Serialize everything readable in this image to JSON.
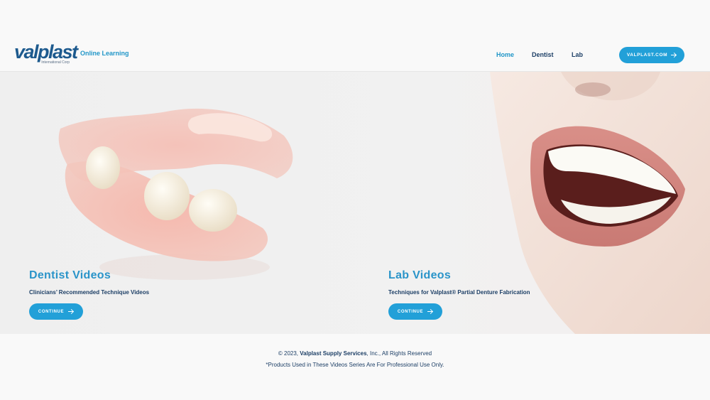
{
  "header": {
    "logo_text": "valplast",
    "logo_subtext": "International Corp",
    "section_label": "Online Learning",
    "nav": [
      {
        "label": "Home",
        "active": true
      },
      {
        "label": "Dentist",
        "active": false
      },
      {
        "label": "Lab",
        "active": false
      }
    ],
    "site_button_label": "VALPLAST.COM"
  },
  "hero": {
    "cards": [
      {
        "title": "Dentist Videos",
        "subtitle": "Clinicians’ Recommended Technique Videos",
        "button_label": "CONTINUE"
      },
      {
        "title": "Lab Videos",
        "subtitle": "Techniques for Valplast® Partial Denture Fabrication",
        "button_label": "CONTINUE"
      }
    ]
  },
  "footer": {
    "copyright_prefix": "© 2023,",
    "company": "Valplast Supply Services",
    "copyright_suffix": ", Inc., All Rights Reserved",
    "notice": "*Products Used in These Videos Series Are For Professional Use Only."
  },
  "colors": {
    "accent": "#22a0d8",
    "brand_navy": "#1d5a8e",
    "text_dark": "#1d3f66",
    "link_blue": "#2196c8"
  }
}
